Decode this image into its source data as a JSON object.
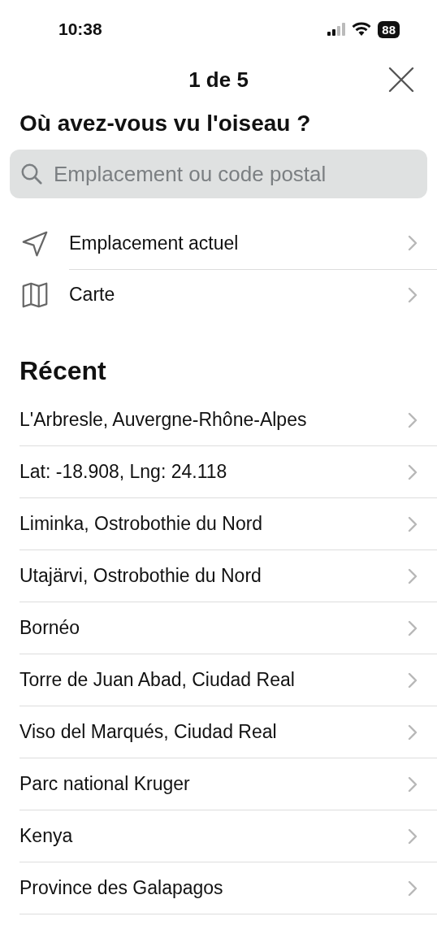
{
  "status_bar": {
    "time": "10:38",
    "battery": "88"
  },
  "header": {
    "step": "1 de 5"
  },
  "title": "Où avez-vous vu l'oiseau ?",
  "search": {
    "placeholder": "Emplacement ou code postal"
  },
  "options": [
    {
      "kind": "location",
      "label": "Emplacement actuel"
    },
    {
      "kind": "map",
      "label": "Carte"
    }
  ],
  "recent": {
    "heading": "Récent",
    "items": [
      "L'Arbresle, Auvergne-Rhône-Alpes",
      "Lat: -18.908, Lng: 24.118",
      "Liminka, Ostrobothie du Nord",
      "Utajärvi, Ostrobothie du Nord",
      "Bornéo",
      "Torre de Juan Abad, Ciudad Real",
      "Viso del Marqués, Ciudad Real",
      "Parc national Kruger",
      "Kenya",
      "Province des Galapagos"
    ]
  }
}
